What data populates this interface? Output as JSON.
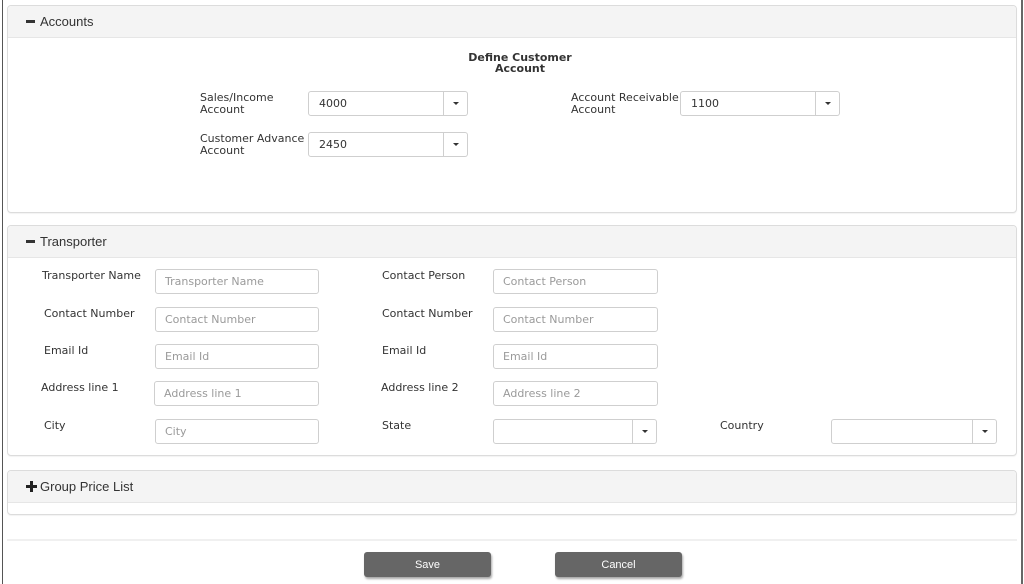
{
  "accounts": {
    "header": "Accounts",
    "toggle_icon": "minus-icon",
    "title_line1": "Define Customer",
    "title_line2": "Account",
    "sales_income": {
      "label_line1": "Sales/Income",
      "label_line2": "Account",
      "value": "4000"
    },
    "customer_advance": {
      "label_line1": "Customer Advance",
      "label_line2": "Account",
      "value": "2450"
    },
    "account_receivable": {
      "label_line1": "Account Receivable",
      "label_line2": "Account",
      "value": "1100"
    }
  },
  "transporter": {
    "header": "Transporter",
    "toggle_icon": "minus-icon",
    "fields": {
      "transporter_name": {
        "label": "Transporter Name",
        "placeholder": "Transporter Name",
        "value": ""
      },
      "contact_person": {
        "label": "Contact Person",
        "placeholder": "Contact Person",
        "value": ""
      },
      "contact_number_1": {
        "label": "Contact Number",
        "placeholder": "Contact Number",
        "value": ""
      },
      "contact_number_2": {
        "label": "Contact Number",
        "placeholder": "Contact Number",
        "value": ""
      },
      "email_id_1": {
        "label": "Email Id",
        "placeholder": "Email Id",
        "value": ""
      },
      "email_id_2": {
        "label": "Email Id",
        "placeholder": "Email Id",
        "value": ""
      },
      "address_line_1": {
        "label": "Address line 1",
        "placeholder": "Address line 1",
        "value": ""
      },
      "address_line_2": {
        "label": "Address line 2",
        "placeholder": "Address line 2",
        "value": ""
      },
      "city": {
        "label": "City",
        "placeholder": "City",
        "value": ""
      },
      "state": {
        "label": "State",
        "value": ""
      },
      "country": {
        "label": "Country",
        "value": ""
      }
    }
  },
  "group_price_list": {
    "header": "Group Price List",
    "toggle_icon": "plus-icon"
  },
  "actions": {
    "save_label": "Save",
    "cancel_label": "Cancel"
  }
}
